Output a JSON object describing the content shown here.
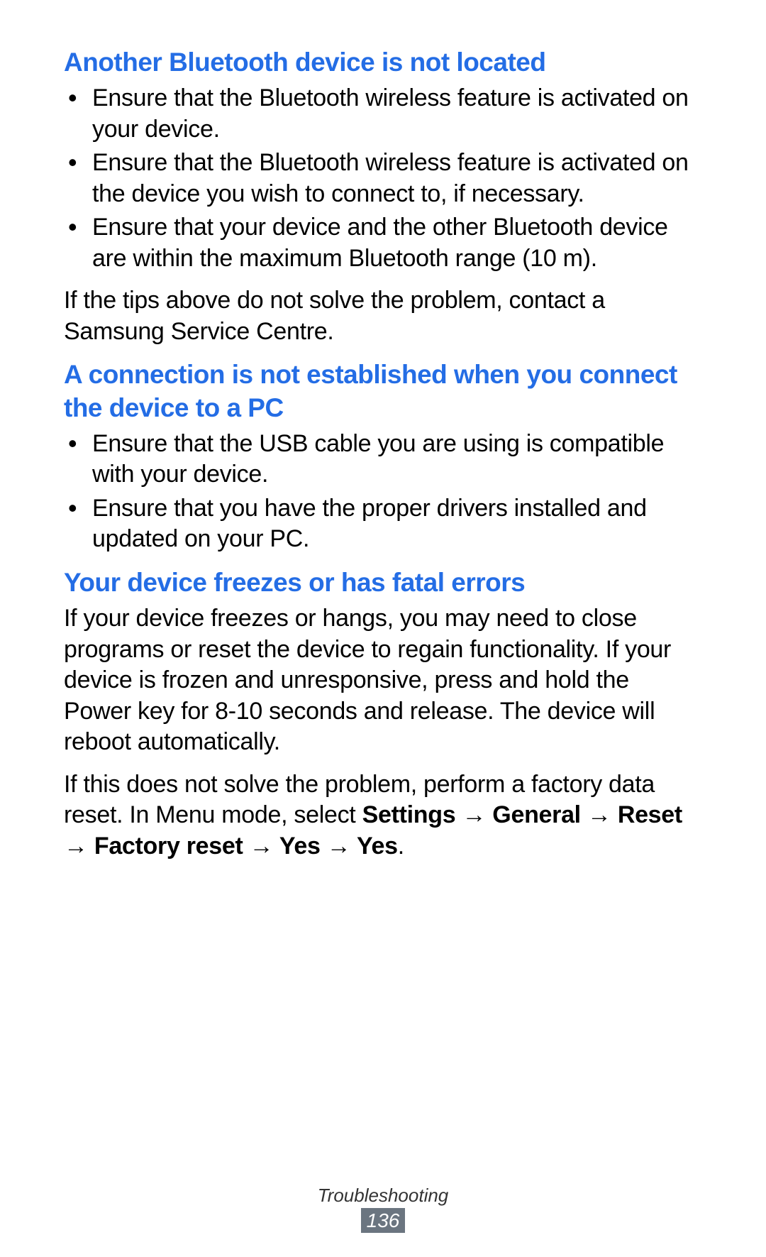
{
  "section1": {
    "heading": "Another Bluetooth device is not located",
    "bullets": [
      "Ensure that the Bluetooth wireless feature is activated on your device.",
      "Ensure that the Bluetooth wireless feature is activated on the device you wish to connect to, if necessary.",
      "Ensure that your device and the other Bluetooth device are within the maximum Bluetooth range (10 m)."
    ],
    "followup": "If the tips above do not solve the problem, contact a Samsung Service Centre."
  },
  "section2": {
    "heading": "A connection is not established when you connect the device to a PC",
    "bullets": [
      "Ensure that the USB cable you are using is compatible with your device.",
      "Ensure that you have the proper drivers installed and updated on your PC."
    ]
  },
  "section3": {
    "heading": "Your device freezes or has fatal errors",
    "para1": "If your device freezes or hangs, you may need to close programs or reset the device to regain functionality. If your device is frozen and unresponsive, press and hold the Power key for 8-10 seconds and release. The device will reboot automatically.",
    "para2_pre": "If this does not solve the problem, perform a factory data reset. In Menu mode, select ",
    "para2_bold": "Settings → General → Reset → Factory reset → Yes → Yes",
    "para2_post": "."
  },
  "footer": {
    "title": "Troubleshooting",
    "page": "136"
  }
}
